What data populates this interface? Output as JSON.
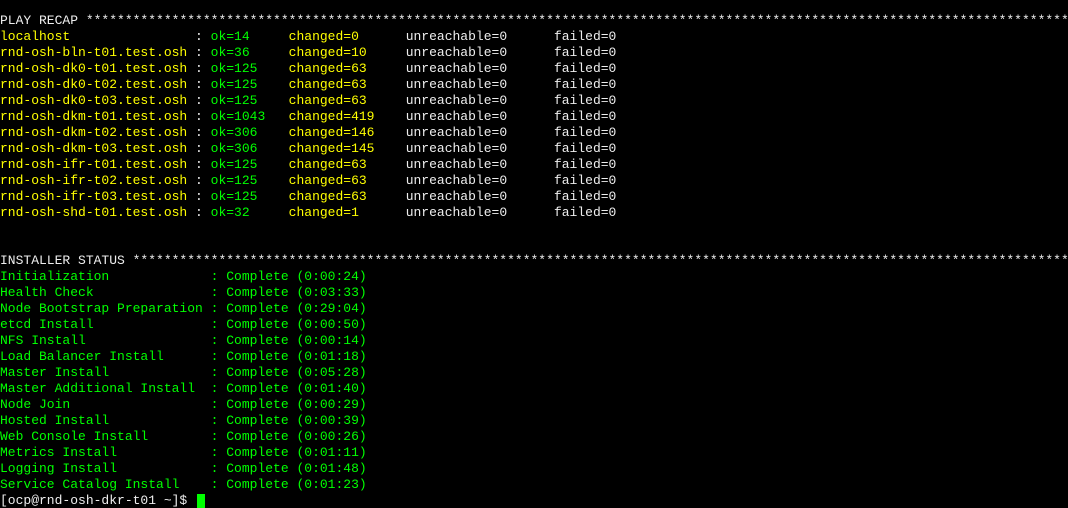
{
  "play_recap": {
    "header": "PLAY RECAP",
    "hosts": [
      {
        "name": "localhost",
        "ok": 14,
        "changed": 0,
        "unreachable": 0,
        "failed": 0
      },
      {
        "name": "rnd-osh-bln-t01.test.osh",
        "ok": 36,
        "changed": 10,
        "unreachable": 0,
        "failed": 0
      },
      {
        "name": "rnd-osh-dk0-t01.test.osh",
        "ok": 125,
        "changed": 63,
        "unreachable": 0,
        "failed": 0
      },
      {
        "name": "rnd-osh-dk0-t02.test.osh",
        "ok": 125,
        "changed": 63,
        "unreachable": 0,
        "failed": 0
      },
      {
        "name": "rnd-osh-dk0-t03.test.osh",
        "ok": 125,
        "changed": 63,
        "unreachable": 0,
        "failed": 0
      },
      {
        "name": "rnd-osh-dkm-t01.test.osh",
        "ok": 1043,
        "changed": 419,
        "unreachable": 0,
        "failed": 0
      },
      {
        "name": "rnd-osh-dkm-t02.test.osh",
        "ok": 306,
        "changed": 146,
        "unreachable": 0,
        "failed": 0
      },
      {
        "name": "rnd-osh-dkm-t03.test.osh",
        "ok": 306,
        "changed": 145,
        "unreachable": 0,
        "failed": 0
      },
      {
        "name": "rnd-osh-ifr-t01.test.osh",
        "ok": 125,
        "changed": 63,
        "unreachable": 0,
        "failed": 0
      },
      {
        "name": "rnd-osh-ifr-t02.test.osh",
        "ok": 125,
        "changed": 63,
        "unreachable": 0,
        "failed": 0
      },
      {
        "name": "rnd-osh-ifr-t03.test.osh",
        "ok": 125,
        "changed": 63,
        "unreachable": 0,
        "failed": 0
      },
      {
        "name": "rnd-osh-shd-t01.test.osh",
        "ok": 32,
        "changed": 1,
        "unreachable": 0,
        "failed": 0
      }
    ]
  },
  "installer_status": {
    "header": "INSTALLER STATUS",
    "stages": [
      {
        "name": "Initialization",
        "status": "Complete",
        "time": "(0:00:24)"
      },
      {
        "name": "Health Check",
        "status": "Complete",
        "time": "(0:03:33)"
      },
      {
        "name": "Node Bootstrap Preparation",
        "status": "Complete",
        "time": "(0:29:04)"
      },
      {
        "name": "etcd Install",
        "status": "Complete",
        "time": "(0:00:50)"
      },
      {
        "name": "NFS Install",
        "status": "Complete",
        "time": "(0:00:14)"
      },
      {
        "name": "Load Balancer Install",
        "status": "Complete",
        "time": "(0:01:18)"
      },
      {
        "name": "Master Install",
        "status": "Complete",
        "time": "(0:05:28)"
      },
      {
        "name": "Master Additional Install",
        "status": "Complete",
        "time": "(0:01:40)"
      },
      {
        "name": "Node Join",
        "status": "Complete",
        "time": "(0:00:29)"
      },
      {
        "name": "Hosted Install",
        "status": "Complete",
        "time": "(0:00:39)"
      },
      {
        "name": "Web Console Install",
        "status": "Complete",
        "time": "(0:00:26)"
      },
      {
        "name": "Metrics Install",
        "status": "Complete",
        "time": "(0:01:11)"
      },
      {
        "name": "Logging Install",
        "status": "Complete",
        "time": "(0:01:48)"
      },
      {
        "name": "Service Catalog Install",
        "status": "Complete",
        "time": "(0:01:23)"
      }
    ]
  },
  "prompt": "[ocp@rnd-osh-dkr-t01 ~]$ ",
  "layout": {
    "header_stars_width": 149,
    "host_col": 25,
    "ok_col": 7,
    "changed_col": 12,
    "unreachable_col": 16,
    "stage_col": 27
  }
}
